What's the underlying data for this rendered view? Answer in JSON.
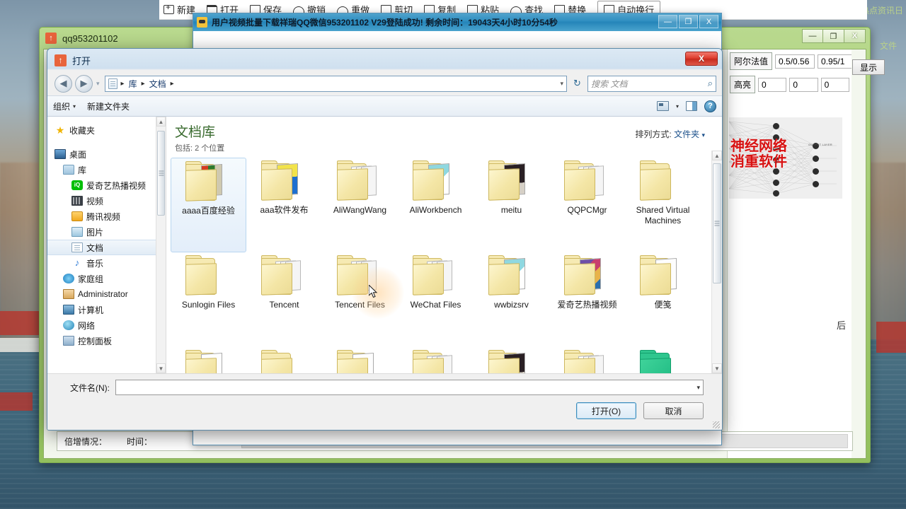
{
  "background_app": {
    "toolbar_items": [
      {
        "label": "新建",
        "icon": "new-icon"
      },
      {
        "label": "打开",
        "icon": "open-icon"
      },
      {
        "label": "保存",
        "icon": "save-icon"
      },
      {
        "label": "撤销",
        "icon": "undo-icon"
      },
      {
        "label": "重做",
        "icon": "redo-icon"
      },
      {
        "label": "剪切",
        "icon": "cut-icon"
      },
      {
        "label": "复制",
        "icon": "copy-icon"
      },
      {
        "label": "粘贴",
        "icon": "paste-icon"
      },
      {
        "label": "查找",
        "icon": "find-icon"
      },
      {
        "label": "替换",
        "icon": "replace-icon"
      },
      {
        "label": "自动换行",
        "icon": "wrap-icon"
      }
    ],
    "overlay_text": "有一大波热点资讯日",
    "side_text": "文件"
  },
  "green_window": {
    "title": "qq953201102",
    "icon": "arrow-up-icon",
    "controls": {
      "minimize": "—",
      "maximize": "❐",
      "close": "X"
    },
    "right_panel": {
      "alpha_label": "阿尔法值",
      "alpha_values": [
        "0.5/0.56",
        "0.95/1"
      ],
      "highlight_label": "高亮",
      "highlight_values": [
        "0",
        "0",
        "0"
      ],
      "image_caption_line1": "神经网络",
      "image_caption_line2": "消重软件",
      "image_output_label": "OUTPUT LAYER",
      "side_label": "后"
    },
    "status": {
      "multiply_label": "倍增情况：",
      "time_label": "时间："
    },
    "show_button": "显示"
  },
  "blue_window": {
    "title": "用户视频批量下载祥瑞QQ微信953201102     V29登陆成功! 剩余时间：19043天4小时10分54秒",
    "icon": "app-icon",
    "controls": {
      "minimize": "—",
      "maximize": "❐",
      "close": "X"
    }
  },
  "dialog": {
    "title": "打开",
    "icon": "arrow-up-icon",
    "close_label": "X",
    "nav": {
      "back_icon": "back-arrow-icon",
      "forward_icon": "forward-arrow-icon",
      "history_caret": "▾",
      "address_icon": "library-icon",
      "breadcrumbs": [
        "库",
        "文档"
      ],
      "separator": "▸",
      "address_caret": "▾",
      "refresh_icon": "refresh-icon"
    },
    "search": {
      "placeholder": "搜索 文档",
      "icon": "search-icon"
    },
    "commandbar": {
      "organize": "组织",
      "organize_caret": "▾",
      "new_folder": "新建文件夹",
      "view_icon": "view-icon",
      "view_caret": "▾",
      "preview_pane_icon": "preview-pane-icon",
      "help_icon": "help-icon",
      "help_glyph": "?"
    },
    "nav_pane": {
      "items": [
        {
          "label": "收藏夹",
          "icon": "star-icon",
          "level": 0,
          "selected": false
        },
        {
          "label": "桌面",
          "icon": "desktop-icon",
          "level": 0,
          "selected": false
        },
        {
          "label": "库",
          "icon": "library-icon",
          "level": 1,
          "selected": false
        },
        {
          "label": "爱奇艺热播视频",
          "icon": "iqiyi-icon",
          "level": 2,
          "selected": false
        },
        {
          "label": "视频",
          "icon": "video-icon",
          "level": 2,
          "selected": false
        },
        {
          "label": "腾讯视频",
          "icon": "tencent-video-icon",
          "level": 2,
          "selected": false
        },
        {
          "label": "图片",
          "icon": "pictures-icon",
          "level": 2,
          "selected": false
        },
        {
          "label": "文档",
          "icon": "documents-icon",
          "level": 2,
          "selected": true
        },
        {
          "label": "音乐",
          "icon": "music-icon",
          "level": 2,
          "selected": false
        },
        {
          "label": "家庭组",
          "icon": "homegroup-icon",
          "level": 1,
          "selected": false
        },
        {
          "label": "Administrator",
          "icon": "user-icon",
          "level": 1,
          "selected": false
        },
        {
          "label": "计算机",
          "icon": "computer-icon",
          "level": 1,
          "selected": false
        },
        {
          "label": "网络",
          "icon": "network-icon",
          "level": 1,
          "selected": false
        },
        {
          "label": "控制面板",
          "icon": "control-panel-icon",
          "level": 1,
          "selected": false
        }
      ],
      "scroll_up": "▲",
      "scroll_down": "▼"
    },
    "library": {
      "title": "文档库",
      "subtitle": "包括: 2 个位置",
      "arrange_label": "排列方式:",
      "arrange_value": "文件夹",
      "arrange_caret": "▾"
    },
    "files": [
      {
        "name": "aaaa百度经验",
        "thumb": "books",
        "selected": true
      },
      {
        "name": "aaa软件发布",
        "thumb": "qr",
        "selected": false
      },
      {
        "name": "AliWangWang",
        "thumb": "papers",
        "selected": false
      },
      {
        "name": "AliWorkbench",
        "thumb": "teal",
        "selected": false
      },
      {
        "name": "meitu",
        "thumb": "movie",
        "selected": false
      },
      {
        "name": "QQPCMgr",
        "thumb": "papers",
        "selected": false
      },
      {
        "name": "Shared Virtual Machines",
        "thumb": "plain",
        "selected": false
      },
      {
        "name": "Sunlogin Files",
        "thumb": "plain",
        "selected": false
      },
      {
        "name": "Tencent",
        "thumb": "papers",
        "selected": false
      },
      {
        "name": "Tencent Files",
        "thumb": "papers",
        "selected": false
      },
      {
        "name": "WeChat Files",
        "thumb": "papers",
        "selected": false
      },
      {
        "name": "wwbizsrv",
        "thumb": "teal",
        "selected": false
      },
      {
        "name": "爱奇艺热播视频",
        "thumb": "poster",
        "selected": false
      },
      {
        "name": "便笺",
        "thumb": "white",
        "selected": false
      }
    ],
    "files_row3": [
      {
        "thumb": "white"
      },
      {
        "thumb": "plain"
      },
      {
        "thumb": "white"
      },
      {
        "thumb": "papers"
      },
      {
        "thumb": "movie"
      },
      {
        "thumb": "papers"
      },
      {
        "thumb": "green"
      }
    ],
    "bottom": {
      "filename_label": "文件名(N):",
      "filename_value": "",
      "filename_caret": "▾",
      "open_button": "打开(O)",
      "cancel_button": "取消"
    }
  },
  "colors": {
    "accent_blue": "#2383b8",
    "green_frame": "#93c05e",
    "selection": "#e3eefa",
    "library_title": "#3a6b2f",
    "close_red": "#de3a2c",
    "caption_red": "#d81212"
  }
}
